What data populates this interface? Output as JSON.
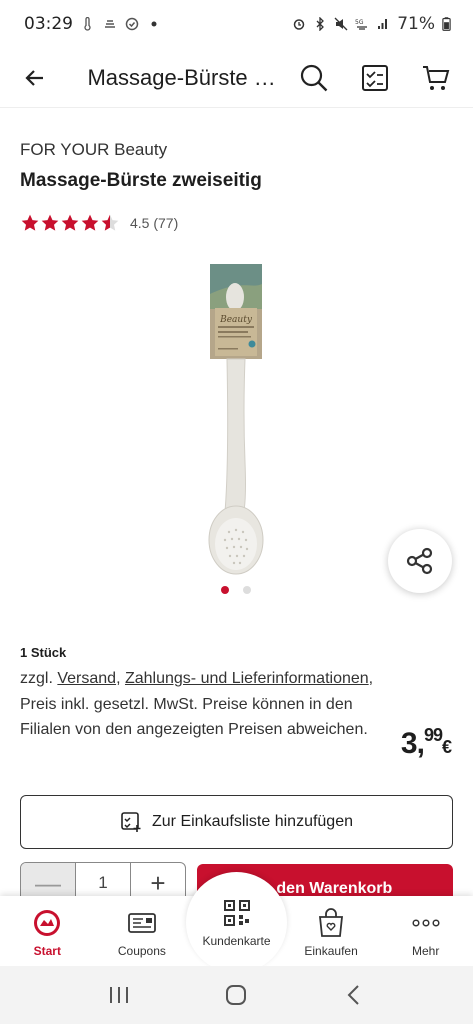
{
  "status_bar": {
    "time": "03:29",
    "battery": "71%"
  },
  "header": {
    "title": "Massage-Bürste zweiseitig",
    "icons": [
      "back-arrow-icon",
      "search-icon",
      "shopping-list-icon",
      "cart-icon"
    ]
  },
  "product": {
    "brand": "FOR YOUR Beauty",
    "name": "Massage-Bürste zweiseitig",
    "rating_value": 4.5,
    "rating_text": "4.5 (77)",
    "quantity_label": "1 Stück",
    "info": {
      "prefix": "zzgl.",
      "versand": "Versand",
      "zahlungs": "Zahlungs- und Lieferinformationen",
      "preis_suffix": ", Preis inkl. gesetzl. MwSt.",
      "hint": "Preise können in den Filialen von den angezeigten Preisen abweichen."
    },
    "price_main": "3,",
    "price_cents": "99",
    "price_currency": "€",
    "image_count": 2,
    "image_active": 1
  },
  "actions": {
    "shopping_list_label": "Zur Einkaufsliste hinzufügen",
    "quantity_value": "1",
    "minus": "—",
    "plus": "+",
    "add_to_cart_label": "In den Warenkorb"
  },
  "bottom_nav": {
    "start": "Start",
    "coupons": "Coupons",
    "kundenkarte": "Kundenkarte",
    "einkaufen": "Einkaufen",
    "mehr": "Mehr"
  },
  "colors": {
    "brand_red": "#c8102e",
    "star": "#c8102e"
  }
}
